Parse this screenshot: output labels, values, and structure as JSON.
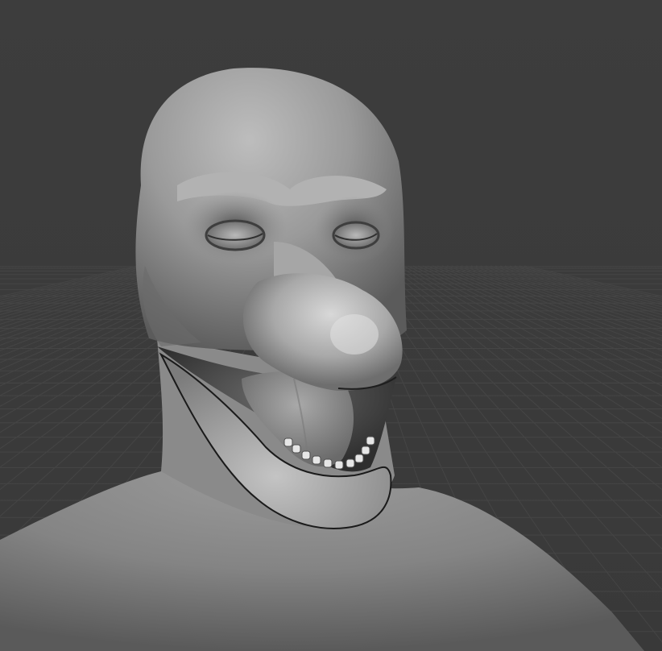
{
  "app": {
    "view": "3d-viewport",
    "mode": "sculpt"
  },
  "viewport": {
    "background_color": "#3d3d3d",
    "grid_color": "#4a4a4a",
    "grid_visible": true,
    "mesh_base_color": "#8e8e8e",
    "mesh_highlight_color": "#cfcfcf",
    "mesh_shadow_color": "#4e4e4e"
  },
  "model": {
    "subject": "sculpted-creature-bust"
  }
}
